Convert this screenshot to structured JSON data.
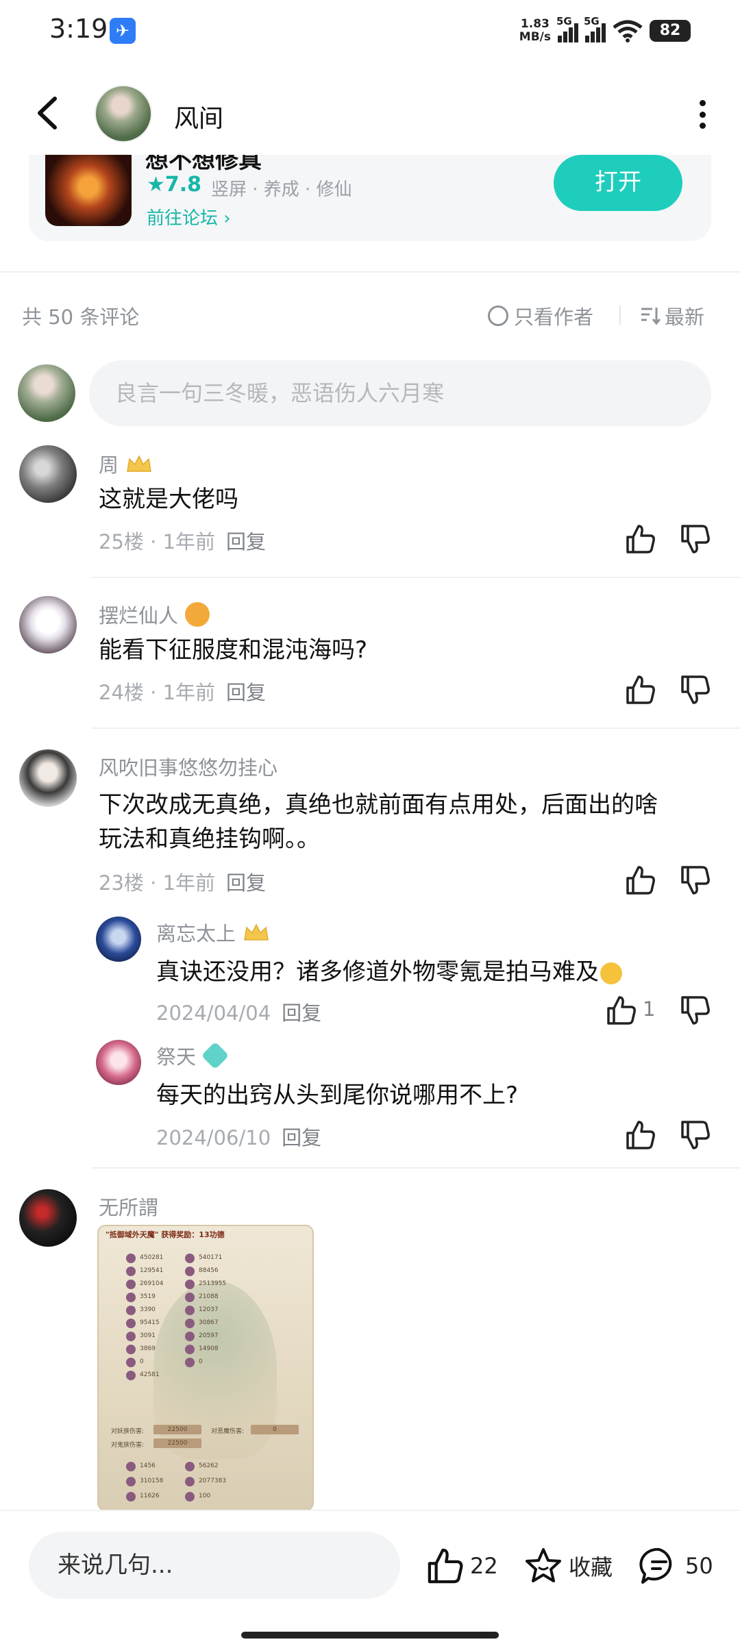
{
  "status_bar": {
    "time": "3:19",
    "net_speed_value": "1.83",
    "net_speed_unit": "MB/s",
    "signal1_label": "5G",
    "signal2_label": "5G",
    "battery": "82"
  },
  "header": {
    "title": "风间"
  },
  "game_card": {
    "name_partial": "想不想修真",
    "rating": "7.8",
    "tags": "竖屏 · 养成 · 修仙",
    "forum_link": "前往论坛",
    "open_button": "打开"
  },
  "comments_header": {
    "count": "共 50 条评论",
    "author_only": "只看作者",
    "sort": "最新"
  },
  "comment_input": {
    "placeholder": "良言一句三冬暖，恶语伤人六月寒"
  },
  "comments": [
    {
      "name": "周",
      "text": "这就是大佬吗",
      "floor": "25楼",
      "time": "1年前",
      "reply": "回复"
    },
    {
      "name": "摆烂仙人",
      "text": "能看下征服度和混沌海吗?",
      "floor": "24楼",
      "time": "1年前",
      "reply": "回复"
    },
    {
      "name": "风吹旧事悠悠勿挂心",
      "text_line1": "下次改成无真绝，真绝也就前面有点用处，后面出的啥",
      "text_line2": "玩法和真绝挂钩啊。。",
      "floor": "23楼",
      "time": "1年前",
      "reply": "回复"
    },
    {
      "name": "无所謂"
    }
  ],
  "replies": [
    {
      "name": "离忘太上",
      "text": "真诀还没用？诸多修道外物零氪是拍马难及",
      "date": "2024/04/04",
      "reply": "回复",
      "likes": "1"
    },
    {
      "name": "祭天",
      "text": "每天的出窍从头到尾你说哪用不上?",
      "date": "2024/06/10",
      "reply": "回复"
    }
  ],
  "comment_image": {
    "title": "\"抵御域外天魔\" 获得奖励：13功德",
    "rows_left": [
      "450281",
      "129541",
      "269104",
      "3519",
      "3390",
      "95415",
      "3091",
      "3869",
      "0",
      "42581"
    ],
    "rows_right": [
      "540171",
      "88456",
      "2513955",
      "21088",
      "12037",
      "30867",
      "20597",
      "14908",
      "0"
    ],
    "dmg_label1": "对妖族伤害:",
    "dmg_value1": "22500",
    "dmg_label2": "对恶魔伤害:",
    "dmg_value2": "0",
    "dmg_label3": "对鬼族伤害:",
    "dmg_value3": "22500",
    "bottom_left": [
      "1456",
      "310158",
      "11626"
    ],
    "bottom_right": [
      "56262",
      "2077383",
      "100"
    ]
  },
  "bottom_bar": {
    "input_placeholder": "来说几句...",
    "likes": "22",
    "favorite": "收藏",
    "comments": "50"
  },
  "colors": {
    "accent": "#1fcdbd",
    "accent_text": "#16b7a8",
    "muted_text": "#8e9399"
  }
}
